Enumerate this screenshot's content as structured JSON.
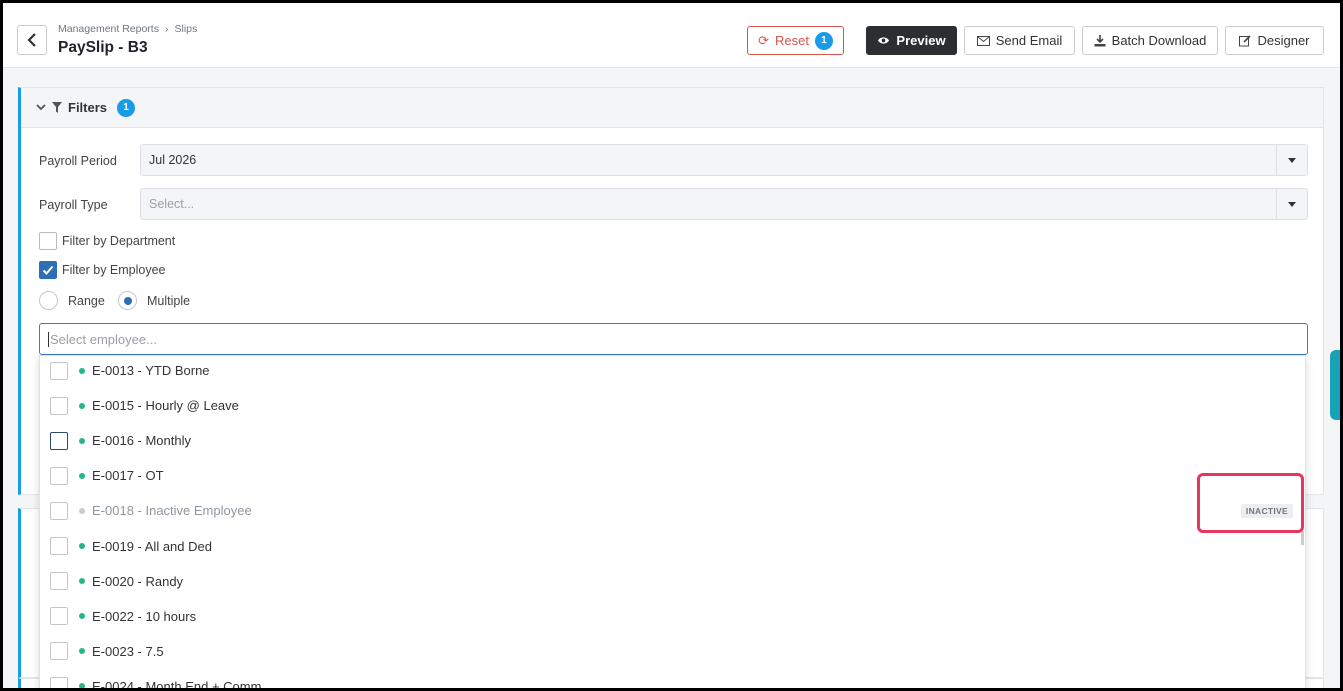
{
  "header": {
    "breadcrumb": [
      "Management Reports",
      "Slips"
    ],
    "title": "PaySlip - B3",
    "buttons": {
      "reset": "Reset",
      "reset_count": "1",
      "preview": "Preview",
      "send_email": "Send Email",
      "batch_download": "Batch Download",
      "designer": "Designer"
    }
  },
  "filters": {
    "title": "Filters",
    "count": "1",
    "payroll_period": {
      "label": "Payroll Period",
      "value": "Jul 2026"
    },
    "payroll_type": {
      "label": "Payroll Type",
      "placeholder": "Select..."
    },
    "filter_by_department": {
      "label": "Filter by Department",
      "checked": false
    },
    "filter_by_employee": {
      "label": "Filter by Employee",
      "checked": true
    },
    "mode": {
      "range": "Range",
      "multiple": "Multiple",
      "selected": "Multiple"
    },
    "employee_search": {
      "placeholder": "Select employee..."
    }
  },
  "employee_options": [
    {
      "label": "E-0013 - YTD Borne",
      "active": true
    },
    {
      "label": "E-0015 - Hourly @ Leave",
      "active": true
    },
    {
      "label": "E-0016 - Monthly",
      "active": true
    },
    {
      "label": "E-0017 - OT",
      "active": true
    },
    {
      "label": "E-0018 - Inactive Employee",
      "active": false,
      "tag": "INACTIVE"
    },
    {
      "label": "E-0019 - All and Ded",
      "active": true
    },
    {
      "label": "E-0020 - Randy",
      "active": true
    },
    {
      "label": "E-0022 - 10 hours",
      "active": true
    },
    {
      "label": "E-0023 - 7.5",
      "active": true
    },
    {
      "label": "E-0024 - Month End + Comm",
      "active": true
    }
  ],
  "colors": {
    "accent": "#1a9be8",
    "reset": "#d9534f",
    "active_dot": "#26b589",
    "inactive_dot": "#c8cdd3",
    "highlight": "#e8365d"
  }
}
